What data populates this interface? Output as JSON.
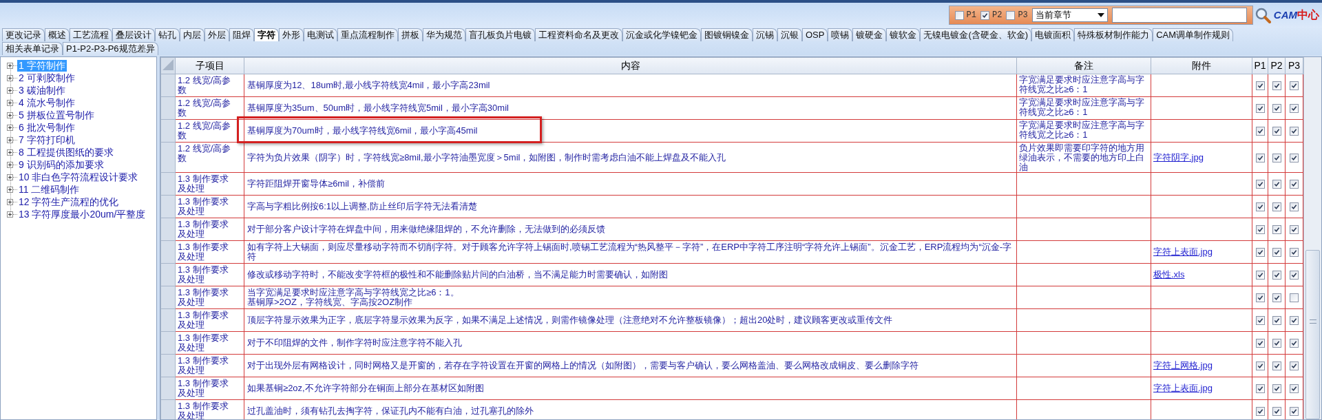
{
  "top_bar": {
    "filters": [
      {
        "label": "P1",
        "checked": false
      },
      {
        "label": "P2",
        "checked": true
      },
      {
        "label": "P3",
        "checked": false
      }
    ],
    "scope_select": {
      "value": "当前章节"
    },
    "logo": {
      "latin": "CAM",
      "chinese": "中心"
    }
  },
  "tab_rows": [
    [
      {
        "label": "更改记录",
        "selected": false
      },
      {
        "label": "概述",
        "selected": false
      },
      {
        "label": "工艺流程",
        "selected": false
      },
      {
        "label": "叠层设计",
        "selected": false
      },
      {
        "label": "钻孔",
        "selected": false
      },
      {
        "label": "内层",
        "selected": false
      },
      {
        "label": "外层",
        "selected": false
      },
      {
        "label": "阻焊",
        "selected": false
      },
      {
        "label": "字符",
        "selected": true
      },
      {
        "label": "外形",
        "selected": false
      },
      {
        "label": "电测试",
        "selected": false
      },
      {
        "label": "重点流程制作",
        "selected": false
      },
      {
        "label": "拼板",
        "selected": false
      },
      {
        "label": "华为规范",
        "selected": false
      },
      {
        "label": "盲孔板负片电镀",
        "selected": false
      },
      {
        "label": "工程资料命名及更改",
        "selected": false
      },
      {
        "label": "沉金或化学镍钯金",
        "selected": false
      },
      {
        "label": "图镀铜镍金",
        "selected": false
      },
      {
        "label": "沉锡",
        "selected": false
      },
      {
        "label": "沉银",
        "selected": false
      },
      {
        "label": "OSP",
        "selected": false
      },
      {
        "label": "喷锡",
        "selected": false
      },
      {
        "label": "镀硬金",
        "selected": false
      },
      {
        "label": "镀软金",
        "selected": false
      },
      {
        "label": "无镍电镀金(含硬金、软金)",
        "selected": false
      },
      {
        "label": "电镀面积",
        "selected": false
      },
      {
        "label": "特殊板材制作能力",
        "selected": false
      },
      {
        "label": "CAM调单制作规则",
        "selected": false
      }
    ],
    [
      {
        "label": "相关表单记录",
        "selected": false
      },
      {
        "label": "P1-P2-P3-P6规范差异",
        "selected": false
      }
    ]
  ],
  "sidebar": {
    "items": [
      {
        "label": "1 字符制作",
        "selected": true,
        "expanded": false
      },
      {
        "label": "2 可剥胶制作",
        "selected": false,
        "expanded": false
      },
      {
        "label": "3 碳油制作",
        "selected": false,
        "expanded": false
      },
      {
        "label": "4 流水号制作",
        "selected": false,
        "expanded": false
      },
      {
        "label": "5 拼板位置号制作",
        "selected": false,
        "expanded": false
      },
      {
        "label": "6 批次号制作",
        "selected": false,
        "expanded": false
      },
      {
        "label": "7 字符打印机",
        "selected": false,
        "expanded": false
      },
      {
        "label": "8 工程提供图纸的要求",
        "selected": false,
        "expanded": false
      },
      {
        "label": "9 识别码的添加要求",
        "selected": false,
        "expanded": false
      },
      {
        "label": "10 非白色字符流程设计要求",
        "selected": false,
        "expanded": false
      },
      {
        "label": "11 二维码制作",
        "selected": false,
        "expanded": false
      },
      {
        "label": "12 字符生产流程的优化",
        "selected": false,
        "expanded": false
      },
      {
        "label": "13 字符厚度最小20um/平整度",
        "selected": false,
        "expanded": false
      }
    ]
  },
  "table": {
    "columns": [
      "子项目",
      "内容",
      "备注",
      "附件",
      "P1",
      "P2",
      "P3"
    ],
    "rows": [
      {
        "subitem": "1.2 线宽/高参数",
        "content": "基铜厚度为12、18um时,最小线字符线宽4mil，最小字高23mil",
        "note": "字宽满足要求时应注意字高与字符线宽之比≥6：1",
        "p1": true,
        "p2": true,
        "p3": true,
        "highlighted": false
      },
      {
        "subitem": "1.2 线宽/高参数",
        "content": "基铜厚度为35um、50um时，最小线字符线宽5mil，最小字高30mil",
        "note": "字宽满足要求时应注意字高与字符线宽之比≥6：1",
        "p1": true,
        "p2": true,
        "p3": true,
        "highlighted": false
      },
      {
        "subitem": "1.2 线宽/高参数",
        "content": "基铜厚度为70um时，最小线字符线宽6mil，最小字高45mil",
        "note": "字宽满足要求时应注意字高与字符线宽之比≥6：1",
        "p1": true,
        "p2": true,
        "p3": true,
        "highlighted": true
      },
      {
        "subitem": "1.2 线宽/高参数",
        "content": "字符为负片效果（阴字）时，字符线宽≥8mil,最小字符油墨宽度＞5mil，如附图，制作时需考虑白油不能上焊盘及不能入孔",
        "note": "负片效果即需要印字符的地方用绿油表示，不需要的地方印上白油",
        "attachment": "字符阴字.jpg",
        "p1": true,
        "p2": true,
        "p3": true,
        "highlighted": false
      },
      {
        "subitem": "1.3 制作要求及处理",
        "content": "字符距阻焊开窗导体≥6mil，补偿前",
        "p1": true,
        "p2": true,
        "p3": true,
        "highlighted": false
      },
      {
        "subitem": "1.3 制作要求及处理",
        "content": "字高与字粗比例按6:1以上调整,防止丝印后字符无法看清楚",
        "p1": true,
        "p2": true,
        "p3": true,
        "highlighted": false
      },
      {
        "subitem": "1.3 制作要求及处理",
        "content": "对于部分客户设计字符在焊盘中间，用来做绝缘阻焊的，不允许删除，无法做到的必须反馈",
        "p1": true,
        "p2": true,
        "p3": true,
        "highlighted": false
      },
      {
        "subitem": "1.3 制作要求及处理",
        "content": "如有字符上大锡面，则应尽量移动字符而不切削字符。对于顾客允许字符上锡面时,喷锡工艺流程为“热风整平－字符”，在ERP中字符工序注明“字符允许上锡面”。沉金工艺，ERP流程均为“沉金-字符",
        "attachment": "字符上表面.jpg",
        "p1": true,
        "p2": true,
        "p3": true,
        "highlighted": false
      },
      {
        "subitem": "1.3 制作要求及处理",
        "content": "修改或移动字符时，不能改变字符框的极性和不能删除贴片间的白油桥，当不满足能力时需要确认，如附图",
        "attachment": "极性.xls",
        "p1": true,
        "p2": true,
        "p3": true,
        "highlighted": false
      },
      {
        "subitem": "1.3 制作要求及处理",
        "content": "当字宽满足要求时应注意字高与字符线宽之比≥6：1。",
        "content_line_2": "基铜厚>2OZ，字符线宽、字高按2OZ制作",
        "p1": true,
        "p2": true,
        "p3": false,
        "highlighted": false
      },
      {
        "subitem": "1.3 制作要求及处理",
        "content": "顶层字符显示效果为正字，底层字符显示效果为反字，如果不满足上述情况，则需作镜像处理（注意绝对不允许整板镜像）；超出20处时，建议顾客更改或重传文件",
        "p1": true,
        "p2": true,
        "p3": true,
        "highlighted": false
      },
      {
        "subitem": "1.3 制作要求及处理",
        "content": "对于不印阻焊的文件，制作字符时应注意字符不能入孔",
        "p1": true,
        "p2": true,
        "p3": true,
        "highlighted": false
      },
      {
        "subitem": "1.3 制作要求及处理",
        "content": "对于出现外层有网格设计，同时网格又是开窗的，若存在字符设置在开窗的网格上的情况（如附图），需要与客户确认，要么网格盖油、要么网格改成铜皮、要么删除字符",
        "attachment": "字符上网格.jpg",
        "p1": true,
        "p2": true,
        "p3": true,
        "highlighted": false
      },
      {
        "subitem": "1.3 制作要求及处理",
        "content": "如果基铜≥2oz,不允许字符部分在铜面上部分在基材区如附图",
        "attachment": "字符上表面.jpg",
        "p1": true,
        "p2": true,
        "p3": true,
        "highlighted": false
      },
      {
        "subitem": "1.3 制作要求及处理",
        "content": "过孔盖油时，须有钻孔去掏字符，保证孔内不能有白油，过孔塞孔的除外",
        "p1": true,
        "p2": true,
        "p3": true,
        "highlighted": false
      }
    ]
  }
}
